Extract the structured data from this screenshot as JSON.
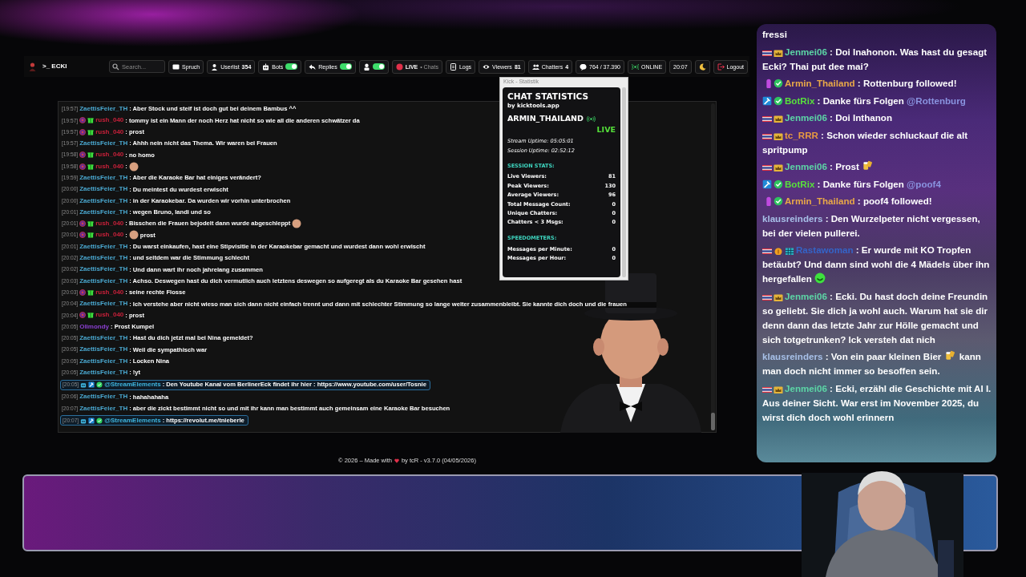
{
  "app": {
    "brand": ">_ ECKI",
    "topbar": [
      {
        "kind": "search",
        "placeholder": "Search..."
      },
      {
        "kind": "button",
        "label": "Spruch"
      },
      {
        "kind": "button",
        "label": "Userlist",
        "count": "354"
      },
      {
        "kind": "toggle",
        "label": "Bots",
        "on": true
      },
      {
        "kind": "toggle",
        "label": "Replies",
        "on": true
      },
      {
        "kind": "toggle",
        "on": true
      },
      {
        "kind": "live",
        "label": "LIVE",
        "sub": "• Chats"
      },
      {
        "kind": "button",
        "label": "Logs"
      },
      {
        "kind": "button",
        "label": "Viewers",
        "count": "81"
      },
      {
        "kind": "button",
        "label": "Chatters",
        "count": "4"
      },
      {
        "kind": "button",
        "label": "764 / 37.390"
      },
      {
        "kind": "status",
        "label": "ONLINE"
      },
      {
        "kind": "clock",
        "label": "20:07"
      },
      {
        "kind": "button"
      },
      {
        "kind": "button",
        "label": "Logout"
      }
    ]
  },
  "chat": {
    "messages": [
      {
        "time": "[19:57]",
        "user": "ZaettisFeier_TH",
        "color": "#4aa8d0",
        "highlighted": false,
        "parts": [
          {
            "kind": "text",
            "text": ": Aber Stock und steif ist doch gut bei deinem Bambus ^^"
          }
        ]
      },
      {
        "time": "[19:57]",
        "user": "rush_040",
        "color": "#c8203a",
        "badges": [
          {
            "kind": "kick"
          },
          {
            "kind": "gift"
          }
        ],
        "highlighted": false,
        "parts": [
          {
            "kind": "text",
            "text": ": tommy ist ein Mann der noch Herz hat nicht so wie all die anderen schwätzer da"
          }
        ]
      },
      {
        "time": "[19:57]",
        "user": "rush_040",
        "color": "#c8203a",
        "badges": [
          {
            "kind": "kick"
          },
          {
            "kind": "gift"
          }
        ],
        "highlighted": false,
        "parts": [
          {
            "kind": "text",
            "text": ": prost"
          }
        ]
      },
      {
        "time": "[19:57]",
        "user": "ZaettisFeier_TH",
        "color": "#4aa8d0",
        "highlighted": false,
        "parts": [
          {
            "kind": "text",
            "text": ": Ahhh nein nicht das Thema. Wir waren bei Frauen"
          }
        ]
      },
      {
        "time": "[19:58]",
        "user": "rush_040",
        "color": "#c8203a",
        "badges": [
          {
            "kind": "kick"
          },
          {
            "kind": "gift"
          }
        ],
        "highlighted": false,
        "parts": [
          {
            "kind": "text",
            "text": ": no homo"
          }
        ]
      },
      {
        "time": "[19:58]",
        "user": "rush_040",
        "color": "#c8203a",
        "badges": [
          {
            "kind": "kick"
          },
          {
            "kind": "gift"
          }
        ],
        "highlighted": false,
        "parts": [
          {
            "kind": "text",
            "text": ":"
          },
          {
            "kind": "face"
          }
        ]
      },
      {
        "time": "[19:59]",
        "user": "ZaettisFeier_TH",
        "color": "#4aa8d0",
        "highlighted": false,
        "parts": [
          {
            "kind": "text",
            "text": ": Aber die Karaoke Bar hat einiges verändert?"
          }
        ]
      },
      {
        "time": "[20:00]",
        "user": "ZaettisFeier_TH",
        "color": "#4aa8d0",
        "highlighted": false,
        "parts": [
          {
            "kind": "text",
            "text": ": Du meintest du wurdest erwischt"
          }
        ]
      },
      {
        "time": "[20:00]",
        "user": "ZaettisFeier_TH",
        "color": "#4aa8d0",
        "highlighted": false,
        "parts": [
          {
            "kind": "text",
            "text": ": in der Karaokebar. Da wurden wir vorhin unterbrochen"
          }
        ]
      },
      {
        "time": "[20:01]",
        "user": "ZaettisFeier_TH",
        "color": "#4aa8d0",
        "highlighted": false,
        "parts": [
          {
            "kind": "text",
            "text": ": wegen Bruno, landi und so"
          }
        ]
      },
      {
        "time": "[20:01]",
        "user": "rush_040",
        "color": "#c8203a",
        "badges": [
          {
            "kind": "kick"
          },
          {
            "kind": "gift"
          }
        ],
        "highlighted": false,
        "parts": [
          {
            "kind": "text",
            "text": ": Bisschen die Frauen bejodelt dann wurde abgeschleppt"
          },
          {
            "kind": "face"
          }
        ]
      },
      {
        "time": "[20:01]",
        "user": "rush_040",
        "color": "#c8203a",
        "badges": [
          {
            "kind": "kick"
          },
          {
            "kind": "gift"
          }
        ],
        "highlighted": false,
        "parts": [
          {
            "kind": "text",
            "text": ":"
          },
          {
            "kind": "face"
          },
          {
            "kind": "text",
            "text": "prost"
          }
        ]
      },
      {
        "time": "[20:01]",
        "user": "ZaettisFeier_TH",
        "color": "#4aa8d0",
        "highlighted": false,
        "parts": [
          {
            "kind": "text",
            "text": ": Du warst einkaufen, hast eine Stipvisitie in der Karaokebar gemacht und wurdest dann wohl erwischt"
          }
        ]
      },
      {
        "time": "[20:02]",
        "user": "ZaettisFeier_TH",
        "color": "#4aa8d0",
        "highlighted": false,
        "parts": [
          {
            "kind": "text",
            "text": ": und seitdem war die Stimmung schlecht"
          }
        ]
      },
      {
        "time": "[20:02]",
        "user": "ZaettisFeier_TH",
        "color": "#4aa8d0",
        "highlighted": false,
        "parts": [
          {
            "kind": "text",
            "text": ": Und dann wart ihr noch jahrelang zusammen"
          }
        ]
      },
      {
        "time": "[20:03]",
        "user": "ZaettisFeier_TH",
        "color": "#4aa8d0",
        "highlighted": false,
        "parts": [
          {
            "kind": "text",
            "text": ": Achso. Deswegen hast du dich vermutlich auch letztens deswegen so aufgeregt als du Karaoke Bar gesehen hast"
          }
        ]
      },
      {
        "time": "[20:03]",
        "user": "rush_040",
        "color": "#c8203a",
        "badges": [
          {
            "kind": "kick"
          },
          {
            "kind": "gift"
          }
        ],
        "highlighted": false,
        "parts": [
          {
            "kind": "text",
            "text": ": seine rechte Flosse"
          }
        ]
      },
      {
        "time": "[20:04]",
        "user": "ZaettisFeier_TH",
        "color": "#4aa8d0",
        "highlighted": false,
        "parts": [
          {
            "kind": "text",
            "text": ": Ich verstehe aber nicht wieso man sich dann nicht einfach trennt und dann mit schlechter Stimmung so lange weiter zusammenbleibt. Sie kannte dich doch und die frauen"
          }
        ]
      },
      {
        "time": "[20:04]",
        "user": "rush_040",
        "color": "#c8203a",
        "badges": [
          {
            "kind": "kick"
          },
          {
            "kind": "gift"
          }
        ],
        "highlighted": false,
        "parts": [
          {
            "kind": "text",
            "text": ": prost"
          }
        ]
      },
      {
        "time": "[20:05]",
        "user": "Olimondy",
        "color": "#8a3fd0",
        "highlighted": false,
        "parts": [
          {
            "kind": "text",
            "text": ": Prost Kumpel"
          }
        ]
      },
      {
        "time": "[20:05]",
        "user": "ZaettisFeier_TH",
        "color": "#4aa8d0",
        "highlighted": false,
        "parts": [
          {
            "kind": "text",
            "text": ": Hast du dich jetzt mal bei Nina gemeldet?"
          }
        ]
      },
      {
        "time": "[20:05]",
        "user": "ZaettisFeier_TH",
        "color": "#4aa8d0",
        "highlighted": false,
        "parts": [
          {
            "kind": "text",
            "text": ": Weil die sympathisch war"
          }
        ]
      },
      {
        "time": "[20:05]",
        "user": "ZaettisFeier_TH",
        "color": "#4aa8d0",
        "highlighted": false,
        "parts": [
          {
            "kind": "text",
            "text": ": Locken Nina"
          }
        ]
      },
      {
        "time": "[20:05]",
        "user": "ZaettisFeier_TH",
        "color": "#4aa8d0",
        "highlighted": false,
        "parts": [
          {
            "kind": "text",
            "text": ": !yt"
          }
        ]
      },
      {
        "time": "[20:05]",
        "user": "@StreamElements",
        "color": "#3fb6e0",
        "badges": [
          {
            "kind": "bot"
          },
          {
            "kind": "mod"
          },
          {
            "kind": "verified"
          }
        ],
        "highlighted": true,
        "parts": [
          {
            "kind": "text",
            "text": ": Den Youtube Kanal vom BerlinerEck findet ihr hier : https://www.youtube.com/user/Tosnie"
          }
        ]
      },
      {
        "time": "[20:06]",
        "user": "ZaettisFeier_TH",
        "color": "#4aa8d0",
        "highlighted": false,
        "parts": [
          {
            "kind": "text",
            "text": ": hahahahaha"
          }
        ]
      },
      {
        "time": "[20:07]",
        "user": "ZaettisFeier_TH",
        "color": "#4aa8d0",
        "highlighted": false,
        "parts": [
          {
            "kind": "text",
            "text": ": aber die zickt bestimmt nicht so und mit ihr kann man bestimmt auch gemeinsam eine Karaoke Bar besuchen"
          }
        ]
      },
      {
        "time": "[20:07]",
        "user": "@StreamElements",
        "color": "#3fb6e0",
        "badges": [
          {
            "kind": "bot"
          },
          {
            "kind": "mod"
          },
          {
            "kind": "verified"
          }
        ],
        "highlighted": true,
        "parts": [
          {
            "kind": "text",
            "text": ": https://revolut.me/tnieberle"
          }
        ]
      }
    ]
  },
  "stats_window": {
    "title": "Kick - Statistik",
    "heading": "CHAT STATISTICS",
    "byline": "by kicktools.app",
    "channel": "ARMIN_THAILAND",
    "live": "LIVE",
    "uptimes": [
      "Stream Uptime: 05:05:01",
      "Session Uptime: 02:52:12"
    ],
    "sections": [
      {
        "title": "SESSION STATS:",
        "rows": [
          {
            "label": "Live Viewers:",
            "value": "81"
          },
          {
            "label": "Peak Viewers:",
            "value": "130"
          },
          {
            "label": "Average Viewers:",
            "value": "96"
          },
          {
            "label": "Total Message Count:",
            "value": "0"
          },
          {
            "label": "Unique Chatters:",
            "value": "0"
          },
          {
            "label": "Chatters < 3 Msgs:",
            "value": "0"
          }
        ]
      },
      {
        "title": "SPEEDOMETERS:",
        "rows": [
          {
            "label": "Messages per Minute:",
            "value": "0"
          },
          {
            "label": "Messages per Hour:",
            "value": "0"
          }
        ]
      }
    ]
  },
  "footer": {
    "before": "© 2026 – Made with",
    "after": "by tcR - v3.7.0 (04/05/2026)"
  },
  "overlay_chat": {
    "messages": [
      {
        "parts": [
          {
            "kind": "text",
            "text": "fressi"
          }
        ]
      },
      {
        "user": "Jenmei06",
        "color": "#5cd6a6",
        "badges": [
          {
            "kind": "flag"
          },
          {
            "kind": "crown"
          }
        ],
        "parts": [
          {
            "kind": "text",
            "text": " : Doi Inahonon. Was hast du gesagt Ecki? Thai put dee mai?"
          }
        ]
      },
      {
        "user": "Armin_Thailand",
        "color": "#e8a848",
        "badges": [
          {
            "kind": "pill"
          },
          {
            "kind": "check"
          }
        ],
        "parts": [
          {
            "kind": "text",
            "text": " : Rottenburg followed!"
          }
        ]
      },
      {
        "user": "BotRix",
        "color": "#58e03c",
        "badges": [
          {
            "kind": "mod"
          },
          {
            "kind": "check"
          }
        ],
        "parts": [
          {
            "kind": "text",
            "text": " : Danke fürs Folgen "
          },
          {
            "kind": "mention",
            "text": "@Rottenburg"
          }
        ]
      },
      {
        "user": "Jenmei06",
        "color": "#5cd6a6",
        "badges": [
          {
            "kind": "flag"
          },
          {
            "kind": "crown"
          }
        ],
        "parts": [
          {
            "kind": "text",
            "text": " : Doi Inthanon"
          }
        ]
      },
      {
        "user": "tc_RRR",
        "color": "#e89a40",
        "badges": [
          {
            "kind": "flag"
          },
          {
            "kind": "crown"
          }
        ],
        "parts": [
          {
            "kind": "text",
            "text": " : Schon wieder schluckauf die alt spritpump"
          }
        ]
      },
      {
        "user": "Jenmei06",
        "color": "#5cd6a6",
        "badges": [
          {
            "kind": "flag"
          },
          {
            "kind": "crown"
          }
        ],
        "parts": [
          {
            "kind": "text",
            "text": " : Prost "
          },
          {
            "kind": "beer"
          }
        ]
      },
      {
        "user": "BotRix",
        "color": "#58e03c",
        "badges": [
          {
            "kind": "mod"
          },
          {
            "kind": "check"
          }
        ],
        "parts": [
          {
            "kind": "text",
            "text": " : Danke fürs Folgen "
          },
          {
            "kind": "mention",
            "text": "@poof4"
          }
        ]
      },
      {
        "user": "Armin_Thailand",
        "color": "#e8a848",
        "badges": [
          {
            "kind": "pill"
          },
          {
            "kind": "check"
          }
        ],
        "parts": [
          {
            "kind": "text",
            "text": " : poof4 followed!"
          }
        ]
      },
      {
        "user": "klausreinders",
        "color": "#a8c0e8",
        "parts": [
          {
            "kind": "text",
            "text": " : Den Wurzelpeter nicht vergessen, bei der vielen pullerei."
          }
        ]
      },
      {
        "user": "Rastawoman",
        "color": "#3464c8",
        "badges": [
          {
            "kind": "flag"
          },
          {
            "kind": "coin"
          },
          {
            "kind": "grid"
          }
        ],
        "parts": [
          {
            "kind": "text",
            "text": " : Er wurde mit KO Tropfen betäubt? Und dann sind wohl die 4 Mädels über ihn hergefallen "
          },
          {
            "kind": "smiley"
          }
        ]
      },
      {
        "user": "Jenmei06",
        "color": "#5cd6a6",
        "badges": [
          {
            "kind": "flag"
          },
          {
            "kind": "crown"
          }
        ],
        "parts": [
          {
            "kind": "text",
            "text": " : Ecki. Du hast doch deine Freundin so geliebt. Sie dich ja wohl auch. Warum hat sie dir denn dann das letzte Jahr zur Hölle gemacht und sich totgetrunken? Ick versteh dat nich"
          }
        ]
      },
      {
        "user": "klausreinders",
        "color": "#a8c0e8",
        "parts": [
          {
            "kind": "text",
            "text": " : Von ein paar kleinen Bier "
          },
          {
            "kind": "beer"
          },
          {
            "kind": "text",
            "text": " kann man doch nicht immer so besoffen sein."
          }
        ]
      },
      {
        "user": "Jenmei06",
        "color": "#5cd6a6",
        "badges": [
          {
            "kind": "flag"
          },
          {
            "kind": "crown"
          }
        ],
        "parts": [
          {
            "kind": "text",
            "text": " : Ecki, erzähl die Geschichte mit AI I. Aus deiner Sicht. War erst im November 2025, du wirst dich doch wohl erinnern"
          }
        ]
      }
    ]
  }
}
